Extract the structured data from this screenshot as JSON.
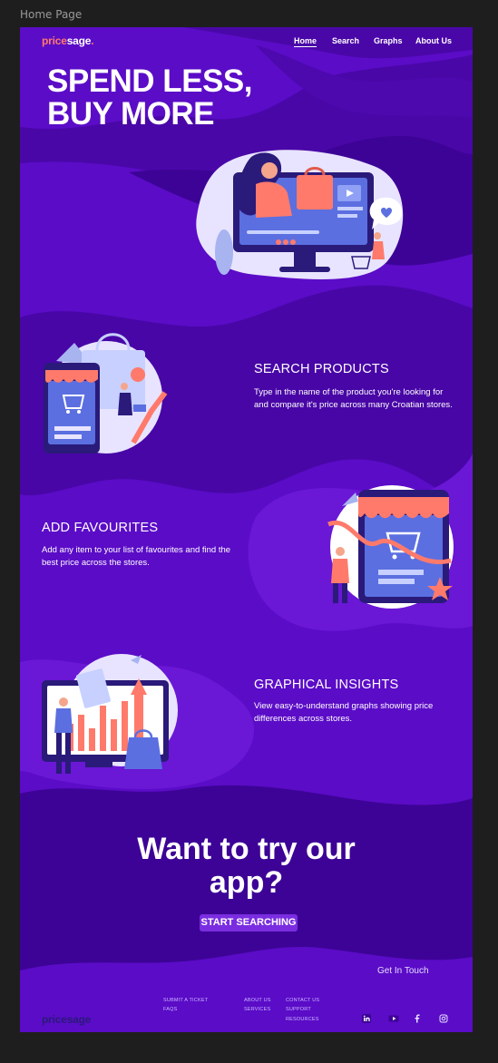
{
  "frame_label": "Home Page",
  "brand": {
    "part1": "price",
    "part2": "sage",
    "dot": ".",
    "footer_part1": "price",
    "footer_part2": "sage"
  },
  "nav": {
    "home": "Home",
    "search": "Search",
    "graphs": "Graphs",
    "about": "About Us"
  },
  "hero": {
    "line1": "SPEND LESS,",
    "line2": "BUY MORE"
  },
  "sections": {
    "search": {
      "title": "SEARCH PRODUCTS",
      "desc": "Type in the name of the product you're looking for and compare it's price across many Croatian stores."
    },
    "favourites": {
      "title": "ADD FAVOURITES",
      "desc": "Add any item to your list of favourites and find the best price across the stores."
    },
    "insights": {
      "title": "GRAPHICAL INSIGHTS",
      "desc": "View easy-to-understand graphs showing price differences across stores."
    }
  },
  "cta": {
    "line1": "Want to try our",
    "line2": "app?",
    "button": "START SEARCHING"
  },
  "footer": {
    "get_in_touch": "Get In Touch",
    "col1": [
      "SUBMIT A TICKET",
      "FAQS"
    ],
    "col2": [
      "ABOUT US",
      "SERVICES"
    ],
    "col3": [
      "CONTACT US",
      "SUPPORT",
      "RESOURCES"
    ],
    "socials": [
      "linkedin-icon",
      "youtube-icon",
      "facebook-icon",
      "instagram-icon"
    ]
  },
  "colors": {
    "bg_purple": "#5b0cc7",
    "dark_purple": "#3d0396",
    "accent_coral": "#ff7a6b",
    "light_lilac": "#e8e4ff"
  }
}
